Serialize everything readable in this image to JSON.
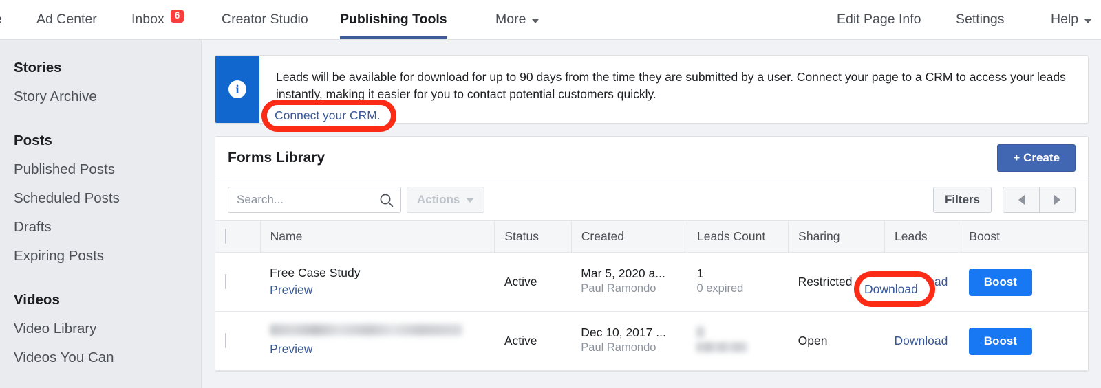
{
  "topnav": {
    "left_items": [
      {
        "label": "e",
        "icon": "",
        "badge": null,
        "active": false
      },
      {
        "label": "Ad Center",
        "icon": "",
        "badge": null,
        "active": false
      },
      {
        "label": "Inbox",
        "icon": "",
        "badge": "6",
        "active": false
      },
      {
        "label": "Creator Studio",
        "icon": "",
        "badge": null,
        "active": false
      },
      {
        "label": "Publishing Tools",
        "icon": "",
        "badge": null,
        "active": true
      },
      {
        "label": "More",
        "icon": "chevron-down-icon",
        "badge": null,
        "active": false
      }
    ],
    "right_items": [
      {
        "label": "Edit Page Info"
      },
      {
        "label": "Settings"
      },
      {
        "label": "Help"
      }
    ]
  },
  "sidebar": {
    "groups": [
      {
        "heading": "Stories",
        "items": [
          {
            "label": "Story Archive"
          }
        ]
      },
      {
        "heading": "Posts",
        "items": [
          {
            "label": "Published Posts"
          },
          {
            "label": "Scheduled Posts"
          },
          {
            "label": "Drafts"
          },
          {
            "label": "Expiring Posts"
          }
        ]
      },
      {
        "heading": "Videos",
        "items": [
          {
            "label": "Video Library"
          },
          {
            "label": "Videos You Can"
          }
        ]
      }
    ]
  },
  "banner": {
    "icon": "info-icon",
    "text": "Leads will be available for download for up to 90 days from the time they are submitted by a user. Connect your page to a CRM to access your leads instantly, making it easier for you to contact potential customers quickly.",
    "link_label": "Connect your CRM.",
    "strip_color": "#1267cf"
  },
  "card": {
    "title": "Forms Library",
    "create_label": "+ Create",
    "create_color": "#4267b2"
  },
  "toolbar": {
    "search_placeholder": "Search...",
    "search_value": "",
    "search_icon": "search-icon",
    "actions_label": "Actions",
    "actions_disabled": true,
    "filters_label": "Filters",
    "prev_icon": "chevron-left-icon",
    "next_icon": "chevron-right-icon"
  },
  "table": {
    "columns": [
      {
        "key": "checkbox",
        "label": ""
      },
      {
        "key": "name",
        "label": "Name"
      },
      {
        "key": "status",
        "label": "Status"
      },
      {
        "key": "created",
        "label": "Created"
      },
      {
        "key": "leads_count",
        "label": "Leads Count"
      },
      {
        "key": "sharing",
        "label": "Sharing"
      },
      {
        "key": "leads",
        "label": "Leads"
      },
      {
        "key": "boost",
        "label": "Boost"
      }
    ],
    "rows": [
      {
        "name": "Free Case Study",
        "name_redacted": false,
        "preview_label": "Preview",
        "status": "Active",
        "created": "Mar 5, 2020 a...",
        "created_by": "Paul Ramondo",
        "leads_count": "1",
        "leads_count_redacted": false,
        "leads_expired": "0 expired",
        "sharing": "Restricted",
        "leads_link": "Download",
        "boost_label": "Boost"
      },
      {
        "name": "",
        "name_redacted": true,
        "preview_label": "Preview",
        "status": "Active",
        "created": "Dec 10, 2017 ...",
        "created_by": "Paul Ramondo",
        "leads_count": "",
        "leads_count_redacted": true,
        "leads_expired": "",
        "sharing": "Open",
        "leads_link": "Download",
        "boost_label": "Boost"
      }
    ]
  },
  "annotations": {
    "color": "#fb2b16",
    "items": [
      {
        "name": "connect-crm-highlight",
        "label": "Connect your CRM."
      },
      {
        "name": "download-highlight",
        "label": "Download"
      }
    ]
  },
  "colors": {
    "brand_blue": "#4267b2",
    "action_blue": "#1877f2",
    "link_blue": "#385898",
    "badge_red": "#fa3e3e",
    "annotation_red": "#fb2b16",
    "sidebar_bg": "#e9ebee",
    "page_bg": "#f0f2f5"
  }
}
